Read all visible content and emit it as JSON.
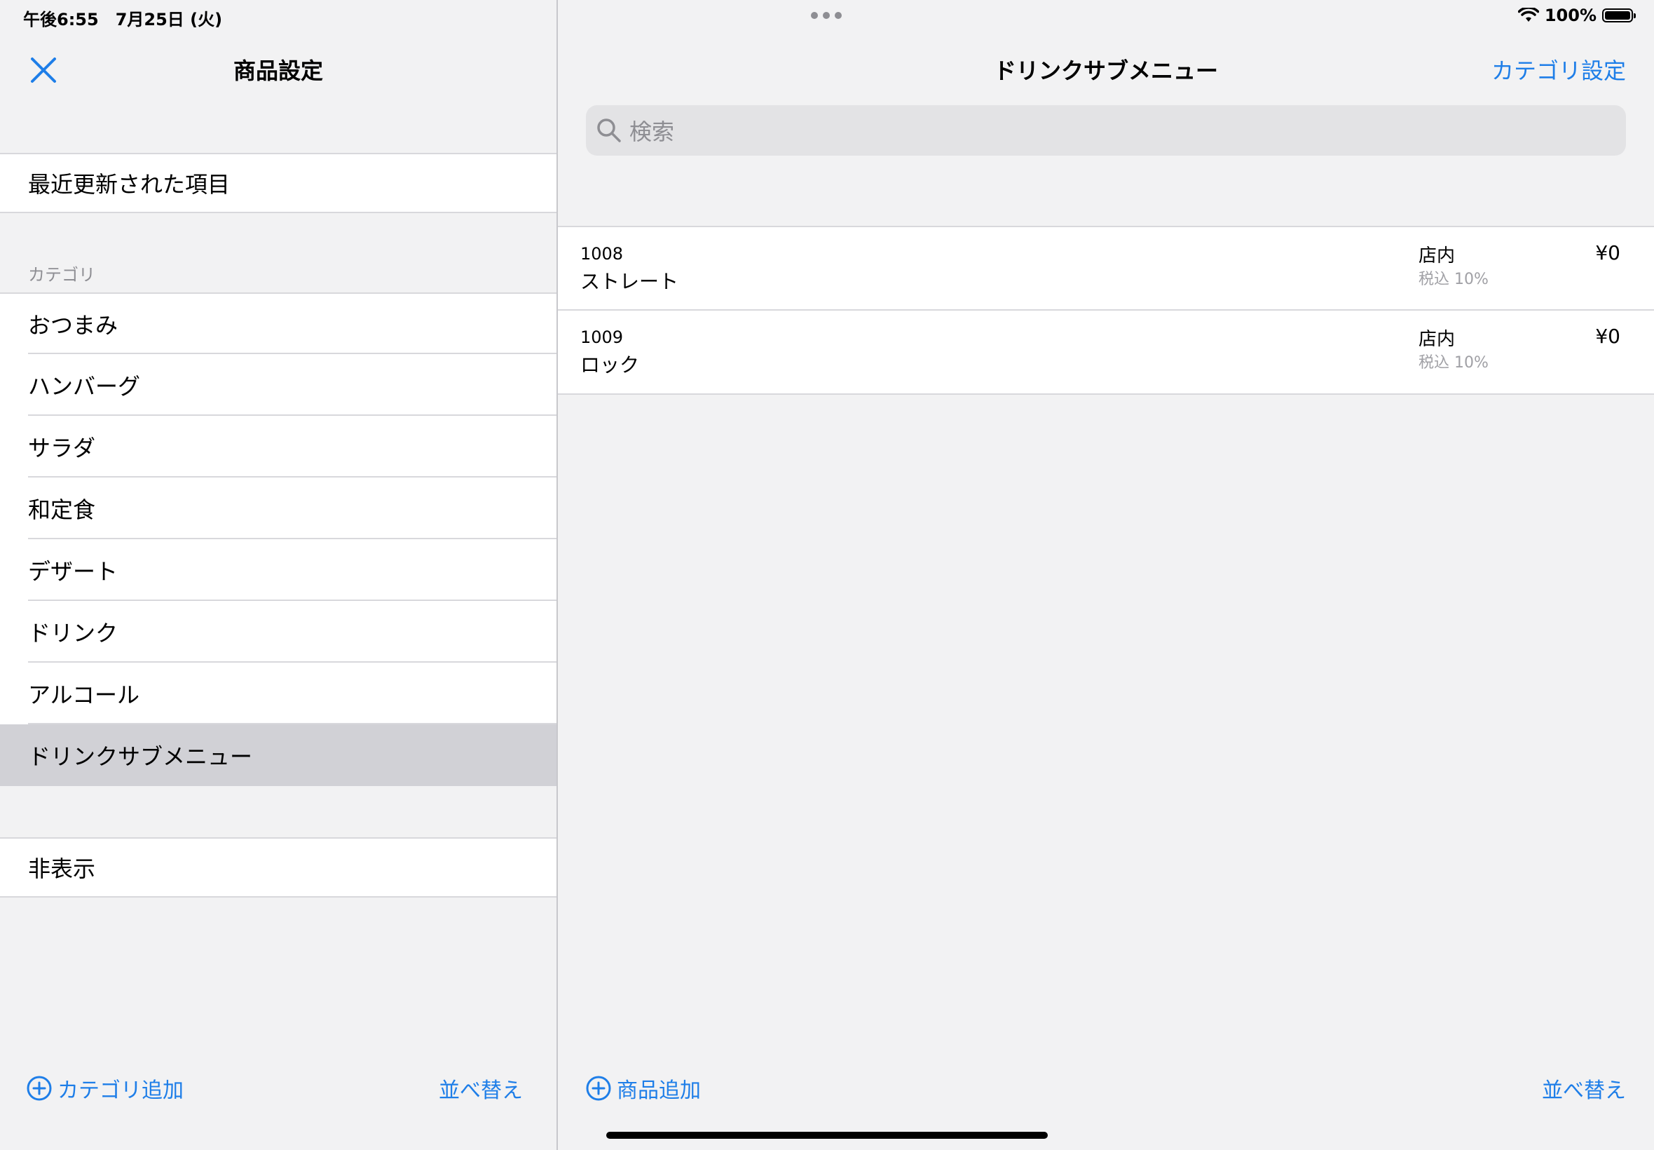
{
  "status_bar": {
    "time": "午後6:55　7月25日 (火)",
    "battery": "100%",
    "icons": [
      "wifi-icon",
      "battery-icon"
    ]
  },
  "left": {
    "title": "商品設定",
    "recent": "最近更新された項目",
    "category_header": "カテゴリ",
    "categories": [
      "おつまみ",
      "ハンバーグ",
      "サラダ",
      "和定食",
      "デザート",
      "ドリンク",
      "アルコール",
      "ドリンクサブメニュー"
    ],
    "selected_category": "ドリンクサブメニュー",
    "hidden": "非表示",
    "add_category": "カテゴリ追加",
    "sort": "並べ替え"
  },
  "right": {
    "title": "ドリンクサブメニュー",
    "category_settings": "カテゴリ設定",
    "search_placeholder": "検索",
    "products": [
      {
        "code": "1008",
        "name": "ストレート",
        "place": "店内",
        "tax": "税込 10%",
        "price": "¥0"
      },
      {
        "code": "1009",
        "name": "ロック",
        "place": "店内",
        "tax": "税込 10%",
        "price": "¥0"
      }
    ],
    "add_product": "商品追加",
    "sort": "並べ替え"
  },
  "colors": {
    "accent": "#1e7ee8",
    "selected_row": "#d1d1d6",
    "background": "#f2f2f3"
  }
}
